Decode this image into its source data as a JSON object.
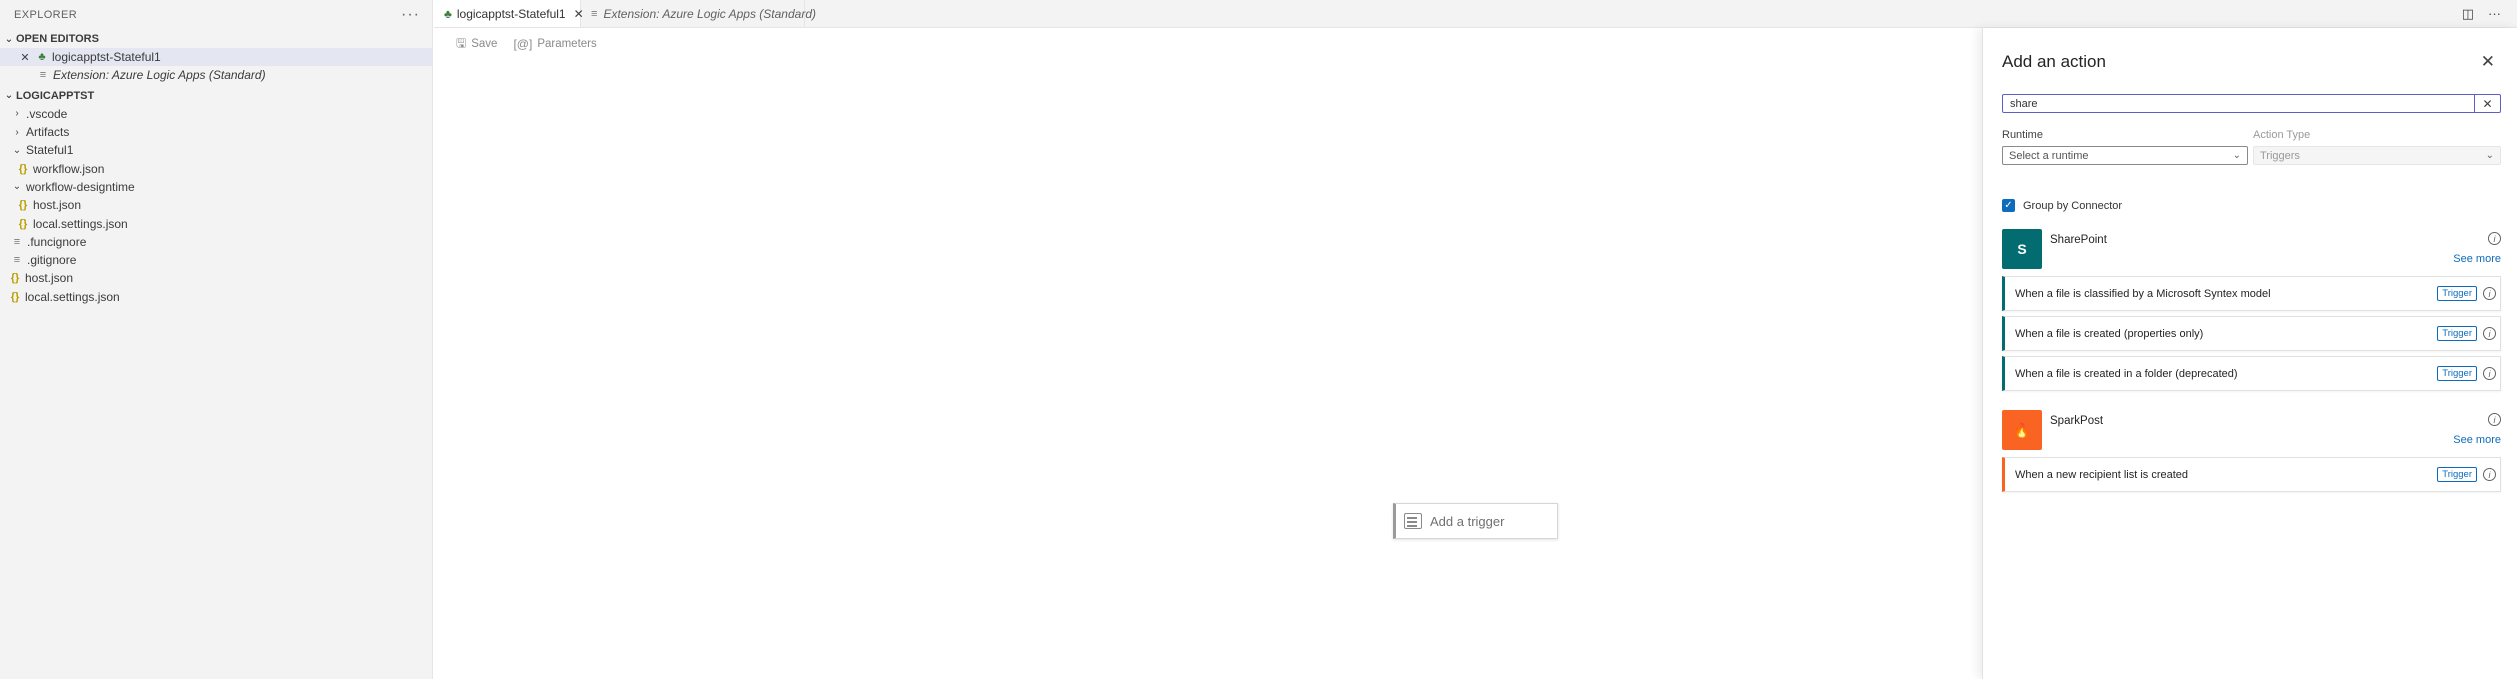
{
  "explorer": {
    "title": "EXPLORER",
    "more": "···",
    "open_editors": {
      "heading": "OPEN EDITORS",
      "items": [
        {
          "label": "logicapptst-Stateful1"
        },
        {
          "label": "Extension: Azure Logic Apps (Standard)"
        }
      ]
    },
    "project": {
      "heading": "LOGICAPPTST",
      "items": [
        {
          "label": ".vscode"
        },
        {
          "label": "Artifacts"
        },
        {
          "label": "Stateful1"
        },
        {
          "label": "workflow.json"
        },
        {
          "label": "workflow-designtime"
        },
        {
          "label": "host.json"
        },
        {
          "label": "local.settings.json"
        },
        {
          "label": ".funcignore"
        },
        {
          "label": ".gitignore"
        },
        {
          "label": "host.json"
        },
        {
          "label": "local.settings.json"
        }
      ]
    }
  },
  "tabs": [
    {
      "label": "logicapptst-Stateful1"
    },
    {
      "label": "Extension: Azure Logic Apps (Standard)"
    }
  ],
  "toolbar": {
    "save_label": "Save",
    "parameters_label": "Parameters"
  },
  "canvas": {
    "trigger_label": "Add a trigger"
  },
  "panel": {
    "title": "Add an action",
    "search_value": "share",
    "runtime_label": "Runtime",
    "runtime_placeholder": "Select a runtime",
    "action_type_label": "Action Type",
    "action_type_value": "Triggers",
    "group_by_label": "Group by Connector",
    "see_more": "See more",
    "connectors": [
      {
        "name": "SharePoint",
        "color": "#036c70",
        "operations": [
          {
            "label": "When a file is classified by a Microsoft Syntex model",
            "badge": "Trigger"
          },
          {
            "label": "When a file is created (properties only)",
            "badge": "Trigger"
          },
          {
            "label": "When a file is created in a folder (deprecated)",
            "badge": "Trigger"
          }
        ]
      },
      {
        "name": "SparkPost",
        "color": "#fa6423",
        "operations": [
          {
            "label": "When a new recipient list is created",
            "badge": "Trigger"
          }
        ]
      }
    ]
  }
}
